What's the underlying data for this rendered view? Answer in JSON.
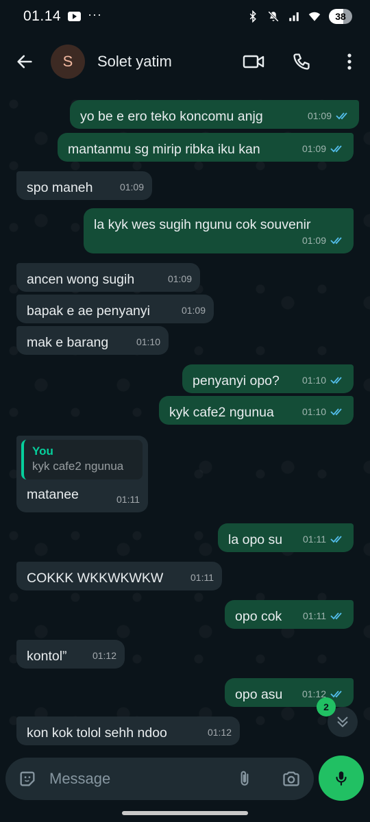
{
  "status_bar": {
    "time": "01.14",
    "battery": "38",
    "icons": [
      "youtube-icon",
      "bluetooth-icon",
      "mute-icon",
      "signal-icon",
      "wifi-icon"
    ]
  },
  "header": {
    "avatar_letter": "S",
    "contact_name": "Solet yatim",
    "actions": [
      "video-call-icon",
      "voice-call-icon",
      "more-options-icon"
    ]
  },
  "messages": [
    {
      "dir": "out",
      "text": "yo be e ero teko koncomu anjg",
      "time": "01:09",
      "read": true
    },
    {
      "dir": "out",
      "text": "mantanmu sg mirip ribka iku kan",
      "time": "01:09",
      "read": true
    },
    {
      "dir": "in",
      "text": "spo maneh",
      "time": "01:09"
    },
    {
      "dir": "out",
      "text": "la kyk wes sugih ngunu cok souvenir",
      "time": "01:09",
      "read": true
    },
    {
      "dir": "in",
      "text": "ancen wong sugih",
      "time": "01:09"
    },
    {
      "dir": "in",
      "text": "bapak e ae penyanyi",
      "time": "01:09"
    },
    {
      "dir": "in",
      "text": "mak e barang",
      "time": "01:10"
    },
    {
      "dir": "out",
      "text": "penyanyi opo?",
      "time": "01:10",
      "read": true
    },
    {
      "dir": "out",
      "text": "kyk cafe2 ngunua",
      "time": "01:10",
      "read": true
    },
    {
      "dir": "in",
      "text": "matanee",
      "time": "01:11",
      "quote": {
        "author": "You",
        "text": "kyk cafe2 ngunua"
      }
    },
    {
      "dir": "out",
      "text": "la opo su",
      "time": "01:11",
      "read": true
    },
    {
      "dir": "in",
      "text": "COKKK WKKWKWKW",
      "time": "01:11"
    },
    {
      "dir": "out",
      "text": "opo cok",
      "time": "01:11",
      "read": true
    },
    {
      "dir": "in",
      "text": "kontol”",
      "time": "01:12"
    },
    {
      "dir": "out",
      "text": "opo asu",
      "time": "01:12",
      "read": true
    },
    {
      "dir": "in",
      "text": "kon kok tolol sehh ndoo",
      "time": "01:12"
    }
  ],
  "scroll_down": {
    "unread_count": "2"
  },
  "composer": {
    "placeholder": "Message"
  },
  "colors": {
    "outgoing": "#144d37",
    "incoming": "#202c33",
    "accent": "#21c063",
    "read_tick": "#53bdeb"
  }
}
